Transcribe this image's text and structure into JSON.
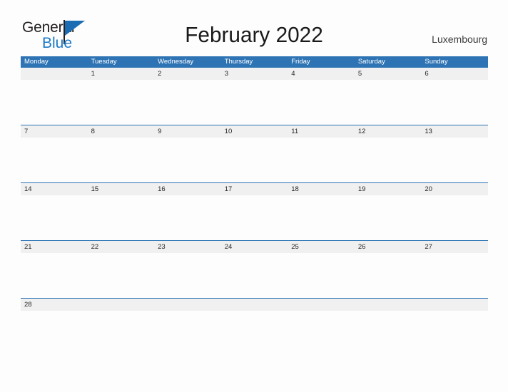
{
  "brand": {
    "name_part1": "General",
    "name_part2": "Blue",
    "logo_icon": "blue-flag-triangle",
    "color_dark": "#231f20",
    "color_blue": "#1b79c8"
  },
  "header": {
    "title": "February 2022",
    "country": "Luxembourg"
  },
  "calendar": {
    "header_bg": "#2e74b5",
    "band_bg": "#f0f0f0",
    "month": "February",
    "year": "2022",
    "weekdays": [
      "Monday",
      "Tuesday",
      "Wednesday",
      "Thursday",
      "Friday",
      "Saturday",
      "Sunday"
    ],
    "weeks": [
      {
        "days": [
          "",
          "1",
          "2",
          "3",
          "4",
          "5",
          "6"
        ]
      },
      {
        "days": [
          "7",
          "8",
          "9",
          "10",
          "11",
          "12",
          "13"
        ]
      },
      {
        "days": [
          "14",
          "15",
          "16",
          "17",
          "18",
          "19",
          "20"
        ]
      },
      {
        "days": [
          "21",
          "22",
          "23",
          "24",
          "25",
          "26",
          "27"
        ]
      },
      {
        "days": [
          "28",
          "",
          "",
          "",
          "",
          "",
          ""
        ]
      }
    ]
  }
}
